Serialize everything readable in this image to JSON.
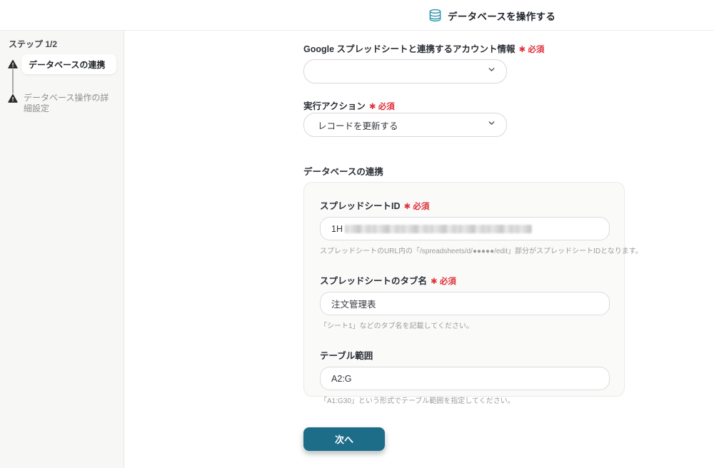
{
  "header": {
    "title": "データベースを操作する"
  },
  "sidebar": {
    "step_label": "ステップ 1/2",
    "items": [
      {
        "label": "データベースの連携",
        "state": "active"
      },
      {
        "label": "データベース操作の詳細設定",
        "state": "inactive"
      }
    ]
  },
  "form": {
    "required_badge": "✱ 必須",
    "account": {
      "label": "Google スプレッドシートと連携するアカウント情報",
      "value": "(redacted)"
    },
    "action": {
      "label": "実行アクション",
      "value": "レコードを更新する"
    },
    "section": {
      "title": "データベースの連携",
      "fields": [
        {
          "label": "スプレッドシートID",
          "value_prefix": "1H",
          "value_redacted": true,
          "helper": "スプレッドシートのURL内の「/spreadsheets/d/●●●●●/edit」部分がスプレッドシートIDとなります。"
        },
        {
          "label": "スプレッドシートのタブ名",
          "value": "注文管理表",
          "helper": "「シート1」などのタブ名を記載してください。"
        },
        {
          "label": "テーブル範囲",
          "value": "A2:G",
          "helper": "「A1:G30」という形式でテーブル範囲を指定してください。"
        }
      ]
    },
    "next_label": "次へ"
  },
  "colors": {
    "accent_teal": "#1e6d88",
    "icon_teal": "#2e93ad",
    "required_red": "#e0313c",
    "sidebar_bg": "#f7f7f5",
    "card_bg": "#fafaf9"
  }
}
